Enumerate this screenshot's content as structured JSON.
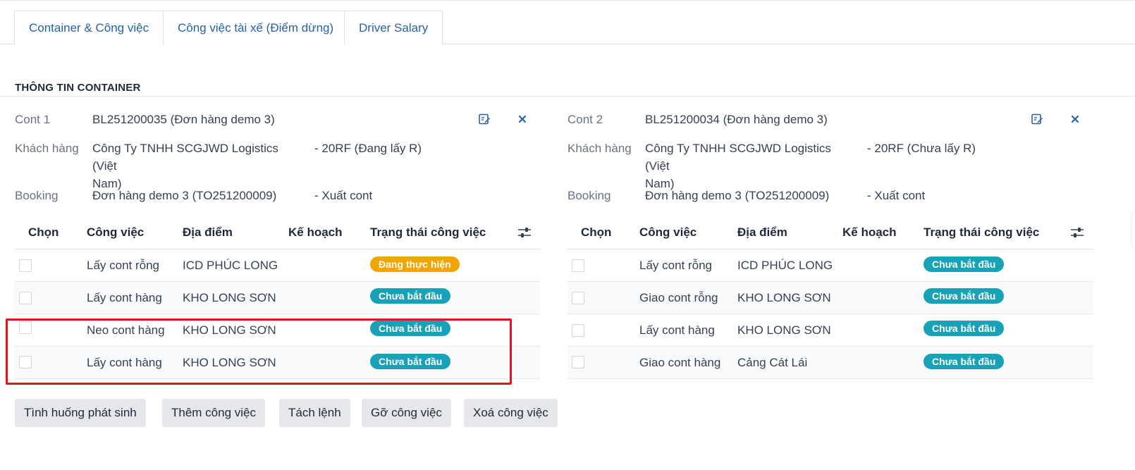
{
  "tabs": [
    {
      "label": "Container & Công việc",
      "active": true
    },
    {
      "label": "Công việc tài xế (Điểm dừng)",
      "active": false
    },
    {
      "label": "Driver Salary",
      "active": false
    }
  ],
  "section": {
    "title": "THÔNG TIN CONTAINER"
  },
  "labels": {
    "customer": "Khách hàng",
    "booking": "Booking"
  },
  "containers": [
    {
      "name": "Cont 1",
      "bl": "BL251200035 (Đơn hàng demo 3)",
      "customer_line1": "Công Ty TNHH SCGJWD Logistics (Việt",
      "customer_line2": "Nam)",
      "type": "- 20RF (Đang lấy R)",
      "booking": "Đơn hàng demo 3 (TO251200009)",
      "booking_type": "- Xuất cont",
      "columns": [
        "Chọn",
        "Công việc",
        "Địa điểm",
        "Kế hoạch",
        "Trạng thái công việc"
      ],
      "rows": [
        {
          "task": "Lấy cont rỗng",
          "location": "ICD PHÚC LONG",
          "status": "Đang thực hiện"
        },
        {
          "task": "Lấy cont hàng",
          "location": "KHO LONG SƠN",
          "status": "Chưa bắt đầu"
        },
        {
          "task": "Neo cont hàng",
          "location": "KHO LONG SƠN",
          "status": "Chưa bắt đầu"
        },
        {
          "task": "Lấy cont hàng",
          "location": "KHO LONG SƠN",
          "status": "Chưa bắt đầu"
        }
      ]
    },
    {
      "name": "Cont 2",
      "bl": "BL251200034 (Đơn hàng demo 3)",
      "customer_line1": "Công Ty TNHH SCGJWD Logistics (Việt",
      "customer_line2": "Nam)",
      "type": "- 20RF (Chưa lấy R)",
      "booking": "Đơn hàng demo 3 (TO251200009)",
      "booking_type": "- Xuất cont",
      "columns": [
        "Chọn",
        "Công việc",
        "Địa điểm",
        "Kế hoạch",
        "Trạng thái công việc"
      ],
      "rows": [
        {
          "task": "Lấy cont rỗng",
          "location": "ICD PHÚC LONG",
          "status": "Chưa bắt đầu"
        },
        {
          "task": "Giao cont rỗng",
          "location": "KHO LONG SƠN",
          "status": "Chưa bắt đầu"
        },
        {
          "task": "Lấy cont hàng",
          "location": "KHO LONG SƠN",
          "status": "Chưa bắt đầu"
        },
        {
          "task": "Giao cont hàng",
          "location": "Cảng Cát Lái",
          "status": "Chưa bắt đầu"
        }
      ]
    }
  ],
  "actions": [
    "Tình huống phát sinh",
    "Thêm công việc",
    "Tách lệnh",
    "Gỡ công việc",
    "Xoá công việc"
  ],
  "colors": {
    "accent": "#2563a8",
    "status_in_progress": "#f0a500",
    "status_not_started": "#17a2b8",
    "highlight": "#e0141a"
  },
  "icons": {
    "edit": "edit-icon",
    "remove": "close-icon",
    "column_settings": "sliders-icon"
  }
}
